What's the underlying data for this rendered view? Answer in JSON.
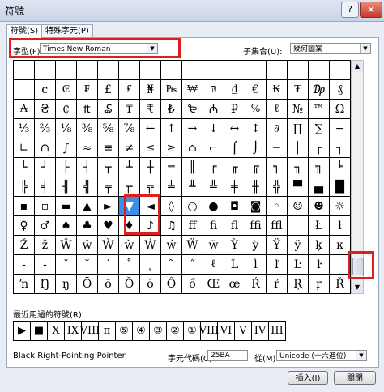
{
  "window": {
    "title": "符號",
    "help": "?",
    "close": "✕"
  },
  "tabs": [
    "符號(S)",
    "特殊字元(P)"
  ],
  "font": {
    "label": "字型(F):",
    "value": "Times New Roman"
  },
  "subset": {
    "label": "子集合(U):",
    "value": "幾何圖案"
  },
  "symbols": [
    [
      "",
      "",
      "",
      "",
      "",
      "",
      "",
      "",
      "",
      "",
      "",
      "",
      "",
      "",
      "",
      ""
    ],
    [
      "",
      "¢",
      "₢",
      "₣",
      "£",
      "₤",
      "₦",
      "₧",
      "₩",
      "₪",
      "₫",
      "€",
      "₭",
      "₮",
      "₯",
      "₰"
    ],
    [
      "₳",
      "₴",
      "₵",
      "₶",
      "₷",
      "₸",
      "₹",
      "₺",
      "₻",
      "₼",
      "₽",
      "℅",
      "ℓ",
      "№",
      "™",
      "Ω"
    ],
    [
      "⅓",
      "⅔",
      "⅛",
      "⅜",
      "⅝",
      "⅞",
      "←",
      "↑",
      "→",
      "↓",
      "↔",
      "↕",
      "∂",
      "∏",
      "∑",
      "−"
    ],
    [
      "∟",
      "∩",
      "∫",
      "≈",
      "≡",
      "≠",
      "≤",
      "≥",
      "⌂",
      "⌐",
      "⌠",
      "⌡",
      "─",
      "│",
      "┌",
      "┐"
    ],
    [
      "└",
      "┘",
      "├",
      "┤",
      "┬",
      "┴",
      "┼",
      "═",
      "║",
      "╒",
      "╓",
      "╔",
      "╕",
      "╖",
      "╗",
      "╘"
    ],
    [
      "╠",
      "╡",
      "╢",
      "╣",
      "╤",
      "╥",
      "╦",
      "╧",
      "╨",
      "╩",
      "╪",
      "╫",
      "╬",
      "▀",
      "▄",
      "█"
    ],
    [
      "▪",
      "▫",
      "▬",
      "▲",
      "►",
      "▼",
      "◄",
      "◊",
      "○",
      "●",
      "◘",
      "◙",
      "◦",
      "☺",
      "☻",
      "☼"
    ],
    [
      "♀",
      "♂",
      "♠",
      "♣",
      "♥",
      "♦",
      "♪",
      "♫",
      "ﬀ",
      "ﬁ",
      "ﬂ",
      "ﬃ",
      "ﬄ",
      "",
      "Ł",
      "ł"
    ],
    [
      "Ž",
      "ž",
      "Ŵ",
      "ŵ",
      "Ẁ",
      "ẁ",
      "Ẃ",
      "ẃ",
      "Ẅ",
      "ẅ",
      "Ỳ",
      "ỳ",
      "Ÿ",
      "ÿ",
      "ķ",
      "ĸ"
    ],
    [
      "‐",
      "‑",
      "ˇ",
      "˘",
      "˙",
      "˚",
      "˛",
      "˜",
      "˝",
      "ℓ",
      "Ĺ",
      "ĺ",
      "ľ",
      "Ŀ",
      "ŀ",
      ""
    ],
    [
      "ŉ",
      "Ŋ",
      "ŋ",
      "Ō",
      "ō",
      "Ŏ",
      "ŏ",
      "Ő",
      "ő",
      "Œ",
      "œ",
      "Ŕ",
      "ŕ",
      "Ŗ",
      "ŗ",
      "Ř"
    ]
  ],
  "recent": {
    "label": "最近用過的符號(R):",
    "items": [
      "▶",
      "■",
      "X",
      "IX",
      "VIII",
      "π",
      "⑤",
      "④",
      "③",
      "②",
      "①",
      "VIII",
      "VI",
      "V",
      "IV",
      "III"
    ]
  },
  "char_name": "Black Right-Pointing Pointer",
  "char_code": {
    "label": "字元代碼(C):",
    "value": "25BA"
  },
  "from": {
    "label": "從(M):",
    "value": "Unicode (十六進位)"
  },
  "buttons": {
    "insert": "插入(I)",
    "close": "關閉"
  }
}
